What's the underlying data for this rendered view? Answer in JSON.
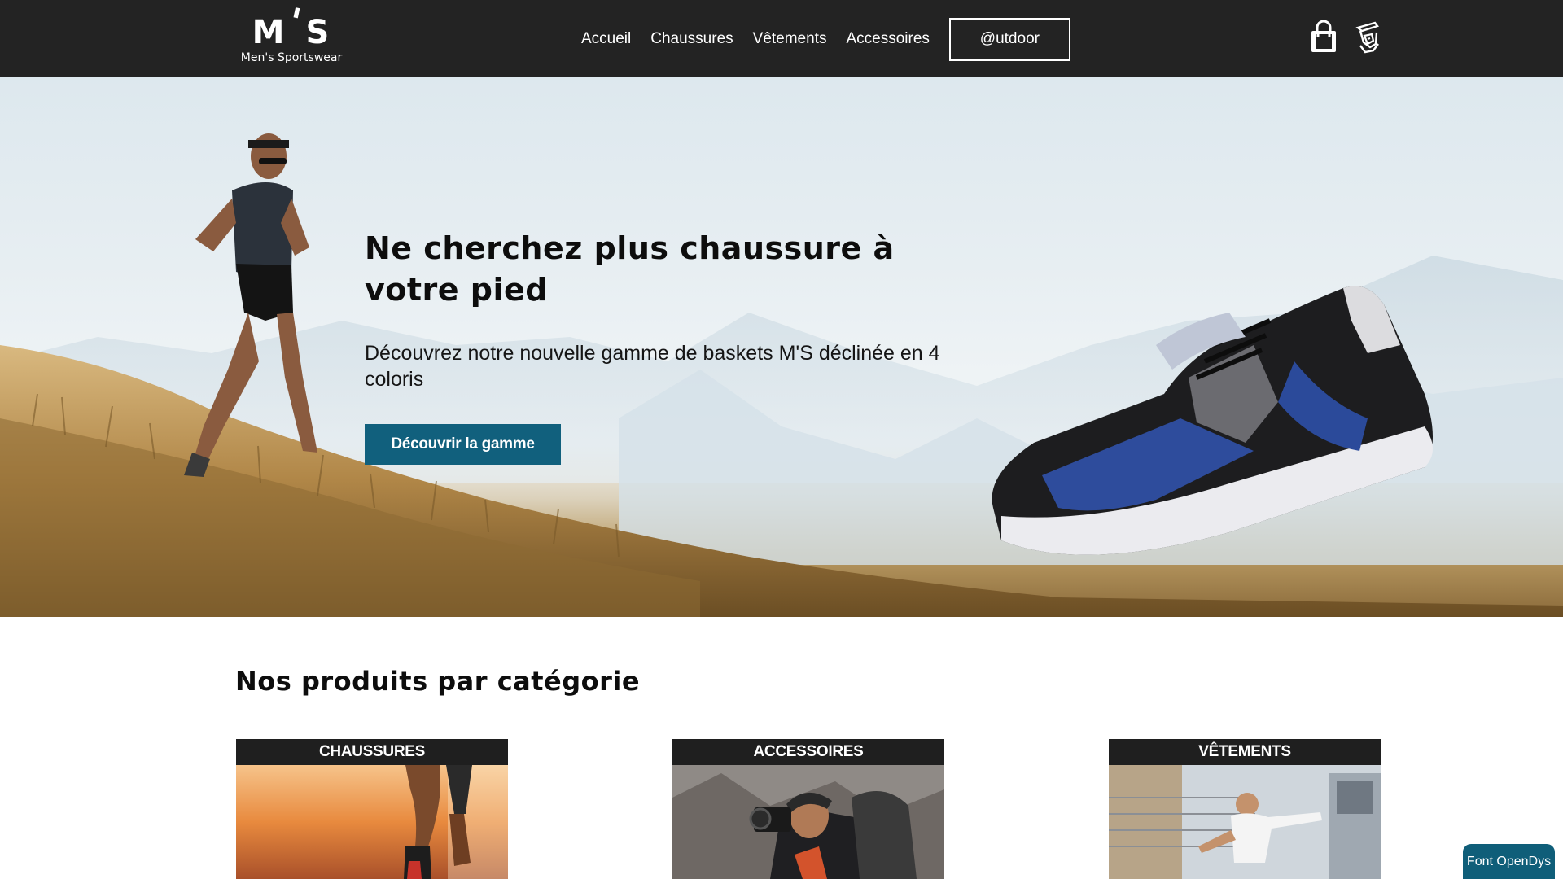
{
  "brand": {
    "logo_mark": "M'S",
    "logo_subtitle": "Men's Sportswear"
  },
  "nav": {
    "items": [
      {
        "label": "Accueil"
      },
      {
        "label": "Chaussures"
      },
      {
        "label": "Vêtements"
      },
      {
        "label": "Accessoires"
      }
    ],
    "outdoor_label": "@utdoor"
  },
  "header_icons": [
    "shopping-bag-icon",
    "user-account-icon"
  ],
  "hero": {
    "title": "Ne cherchez plus chaussure à votre pied",
    "text": "Découvrez notre nouvelle gamme de baskets M'S déclinée en 4 coloris",
    "cta_label": "Découvrir la gamme"
  },
  "categories": {
    "title": "Nos produits par catégorie",
    "items": [
      {
        "label": "CHAUSSURES"
      },
      {
        "label": "ACCESSOIRES"
      },
      {
        "label": "VÊTEMENTS"
      }
    ]
  },
  "font_button": {
    "label": "Font OpenDys"
  },
  "colors": {
    "header_bg": "#232323",
    "cta_bg": "#11607d",
    "category_label_bg": "#1f1f1f",
    "font_button_bg": "#0f5e79"
  }
}
